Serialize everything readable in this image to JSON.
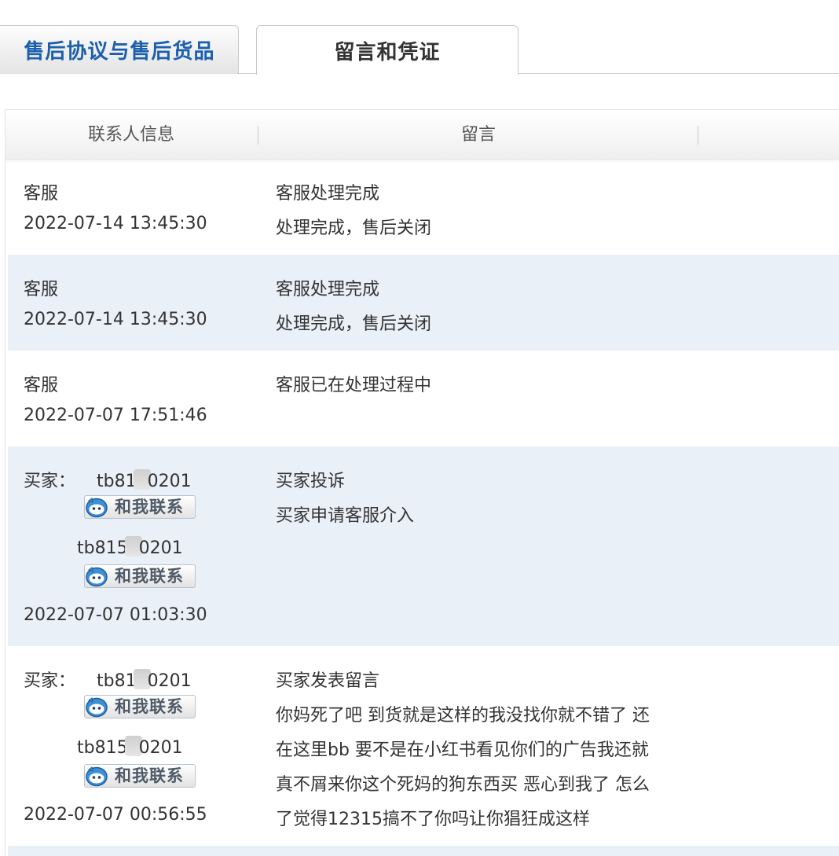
{
  "tabs": [
    {
      "label": "售后协议与售后货品",
      "active": false
    },
    {
      "label": "留言和凭证",
      "active": true
    }
  ],
  "table": {
    "headers": [
      "联系人信息",
      "留言"
    ],
    "rows": [
      {
        "author": "客服",
        "time": "2022-07-14 13:45:30",
        "title": "客服处理完成",
        "body": [
          "处理完成，售后关闭"
        ],
        "alt": false
      },
      {
        "author": "客服",
        "time": "2022-07-14 13:45:30",
        "title": "客服处理完成",
        "body": [
          "处理完成，售后关闭"
        ],
        "alt": true
      },
      {
        "author": "客服",
        "time": "2022-07-07 17:51:46",
        "title": "客服已在处理过程中",
        "body": [],
        "alt": false
      },
      {
        "author_label": "买家：",
        "buyer_name_start": "tb81",
        "buyer_name_end": "0201",
        "buyer_name2_start": "tb815",
        "buyer_name2_end": "0201",
        "contact_label": "和我联系",
        "time": "2022-07-07 01:03:30",
        "title": "买家投诉",
        "body": [
          "买家申请客服介入"
        ],
        "alt": true
      },
      {
        "author_label": "买家：",
        "buyer_name_start": "tb81",
        "buyer_name_end": "0201",
        "buyer_name2_start": "tb815",
        "buyer_name2_end": "0201",
        "contact_label": "和我联系",
        "time": "2022-07-07 00:56:55",
        "title": "买家发表留言",
        "body": [
          "你妈死了吧 到货就是这样的我没找你就不错了 还",
          "在这里bb 要不是在小红书看见你们的广告我还就",
          "真不屑来你这个死妈的狗东西买 恶心到我了 怎么",
          "了觉得12315搞不了你吗让你猖狂成这样"
        ],
        "alt": false
      }
    ]
  },
  "colors": {
    "tab_inactive_text": "#1b5fae",
    "row_alt_bg": "#eaf0f8",
    "text": "#333333"
  },
  "icons": {
    "contact_button": "aliwangwang-icon"
  }
}
